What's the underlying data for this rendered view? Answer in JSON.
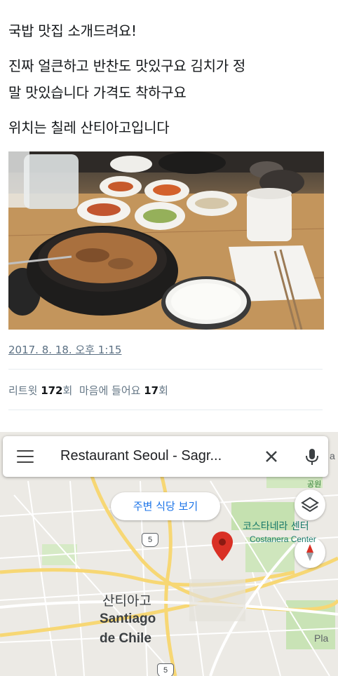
{
  "tweet": {
    "lines": [
      "국밥 맛집 소개드려요!",
      "진짜 얼큰하고 반찬도 맛있구요 김치가 정",
      "말 맛있습니다 가격도 착하구요",
      "위치는 칠레 산티아고입니다"
    ],
    "timestamp": "2017. 8. 18. 오후 1:15",
    "stats": {
      "retweet_label": "리트윗",
      "retweet_count": "172",
      "retweet_unit": "회",
      "like_label": "마음에 들어요",
      "like_count": "17",
      "like_unit": "회"
    }
  },
  "map": {
    "search_query": "Restaurant Seoul - Sagr...",
    "nearby_button_label": "주변 식당 보기",
    "labels": {
      "city_ko": "산티아고",
      "city_en_line1": "Santiago",
      "city_en_line2": "de Chile",
      "costanera_ko": "코스타네라 센터",
      "costanera_en": "Costanera Center",
      "park": "공원",
      "pla": "Pla",
      "edge_a": "a"
    },
    "route_shields": [
      "5",
      "5"
    ],
    "icons": {
      "menu": "menu-icon",
      "close": "close-icon",
      "mic": "mic-icon",
      "layers": "layers-icon",
      "compass": "compass-icon",
      "pin": "location-pin-icon"
    },
    "colors": {
      "pin": "#d93025",
      "accent": "#1a73e8",
      "road_major": "#f7d774",
      "park": "#c5e1b0"
    }
  }
}
